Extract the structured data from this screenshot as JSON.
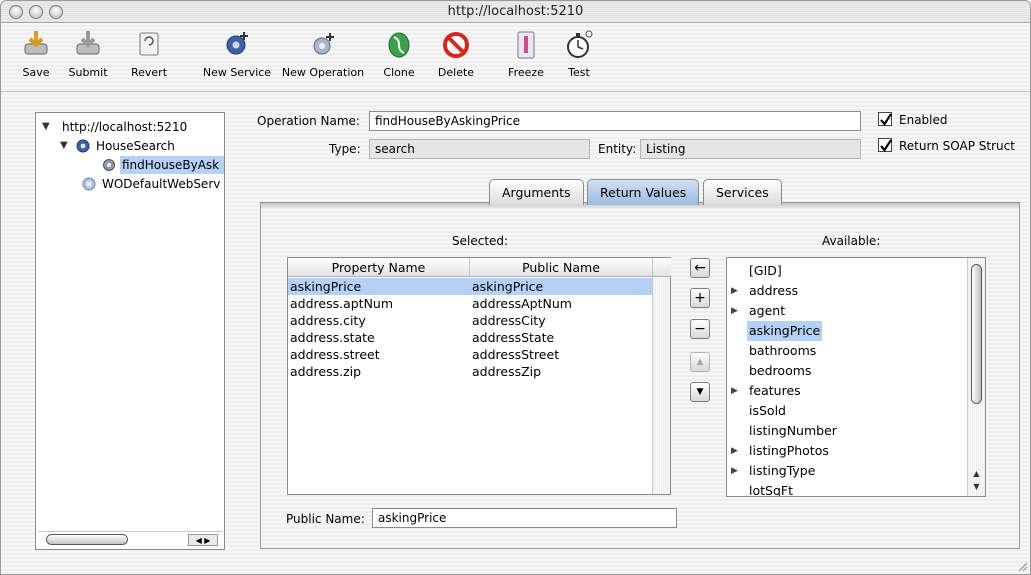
{
  "window": {
    "title": "http://localhost:5210"
  },
  "toolbar": {
    "items": [
      {
        "label": "Save",
        "icon": "save-icon"
      },
      {
        "label": "Submit",
        "icon": "submit-icon"
      },
      {
        "label": "Revert",
        "icon": "revert-icon"
      },
      {
        "label": "New Service",
        "icon": "new-service-icon"
      },
      {
        "label": "New Operation",
        "icon": "new-operation-icon"
      },
      {
        "label": "Clone",
        "icon": "clone-icon"
      },
      {
        "label": "Delete",
        "icon": "delete-icon"
      },
      {
        "label": "Freeze",
        "icon": "freeze-icon"
      },
      {
        "label": "Test",
        "icon": "test-icon"
      }
    ]
  },
  "tree": {
    "root": "http://localhost:5210",
    "service": "HouseSearch",
    "operation": "findHouseByAsk",
    "default_service": "WODefaultWebServ"
  },
  "form": {
    "operation_name_label": "Operation Name:",
    "operation_name": "findHouseByAskingPrice",
    "type_label": "Type:",
    "type": "search",
    "entity_label": "Entity:",
    "entity": "Listing",
    "enabled_label": "Enabled",
    "enabled": true,
    "return_soap_label": "Return SOAP Struct",
    "return_soap": true
  },
  "tabs": [
    {
      "label": "Arguments",
      "active": false
    },
    {
      "label": "Return Values",
      "active": true
    },
    {
      "label": "Services",
      "active": false
    }
  ],
  "selected": {
    "title": "Selected:",
    "columns": [
      "Property Name",
      "Public Name"
    ],
    "rows": [
      {
        "property": "askingPrice",
        "public": "askingPrice",
        "selected": true
      },
      {
        "property": "address.aptNum",
        "public": "addressAptNum",
        "selected": false
      },
      {
        "property": "address.city",
        "public": "addressCity",
        "selected": false
      },
      {
        "property": "address.state",
        "public": "addressState",
        "selected": false
      },
      {
        "property": "address.street",
        "public": "addressStreet",
        "selected": false
      },
      {
        "property": "address.zip",
        "public": "addressZip",
        "selected": false
      }
    ],
    "public_name_label": "Public Name:",
    "public_name_value": "askingPrice"
  },
  "buttons": {
    "move_left": "←",
    "add": "+",
    "remove": "−",
    "up": "▲",
    "down": "▼"
  },
  "available": {
    "title": "Available:",
    "items": [
      {
        "label": "[GID]",
        "expandable": false,
        "selected": false
      },
      {
        "label": "address",
        "expandable": true,
        "selected": false
      },
      {
        "label": "agent",
        "expandable": true,
        "selected": false
      },
      {
        "label": "askingPrice",
        "expandable": false,
        "selected": true
      },
      {
        "label": "bathrooms",
        "expandable": false,
        "selected": false
      },
      {
        "label": "bedrooms",
        "expandable": false,
        "selected": false
      },
      {
        "label": "features",
        "expandable": true,
        "selected": false
      },
      {
        "label": "isSold",
        "expandable": false,
        "selected": false
      },
      {
        "label": "listingNumber",
        "expandable": false,
        "selected": false
      },
      {
        "label": "listingPhotos",
        "expandable": true,
        "selected": false
      },
      {
        "label": "listingType",
        "expandable": true,
        "selected": false
      },
      {
        "label": "lotSqFt",
        "expandable": false,
        "selected": false
      }
    ]
  }
}
